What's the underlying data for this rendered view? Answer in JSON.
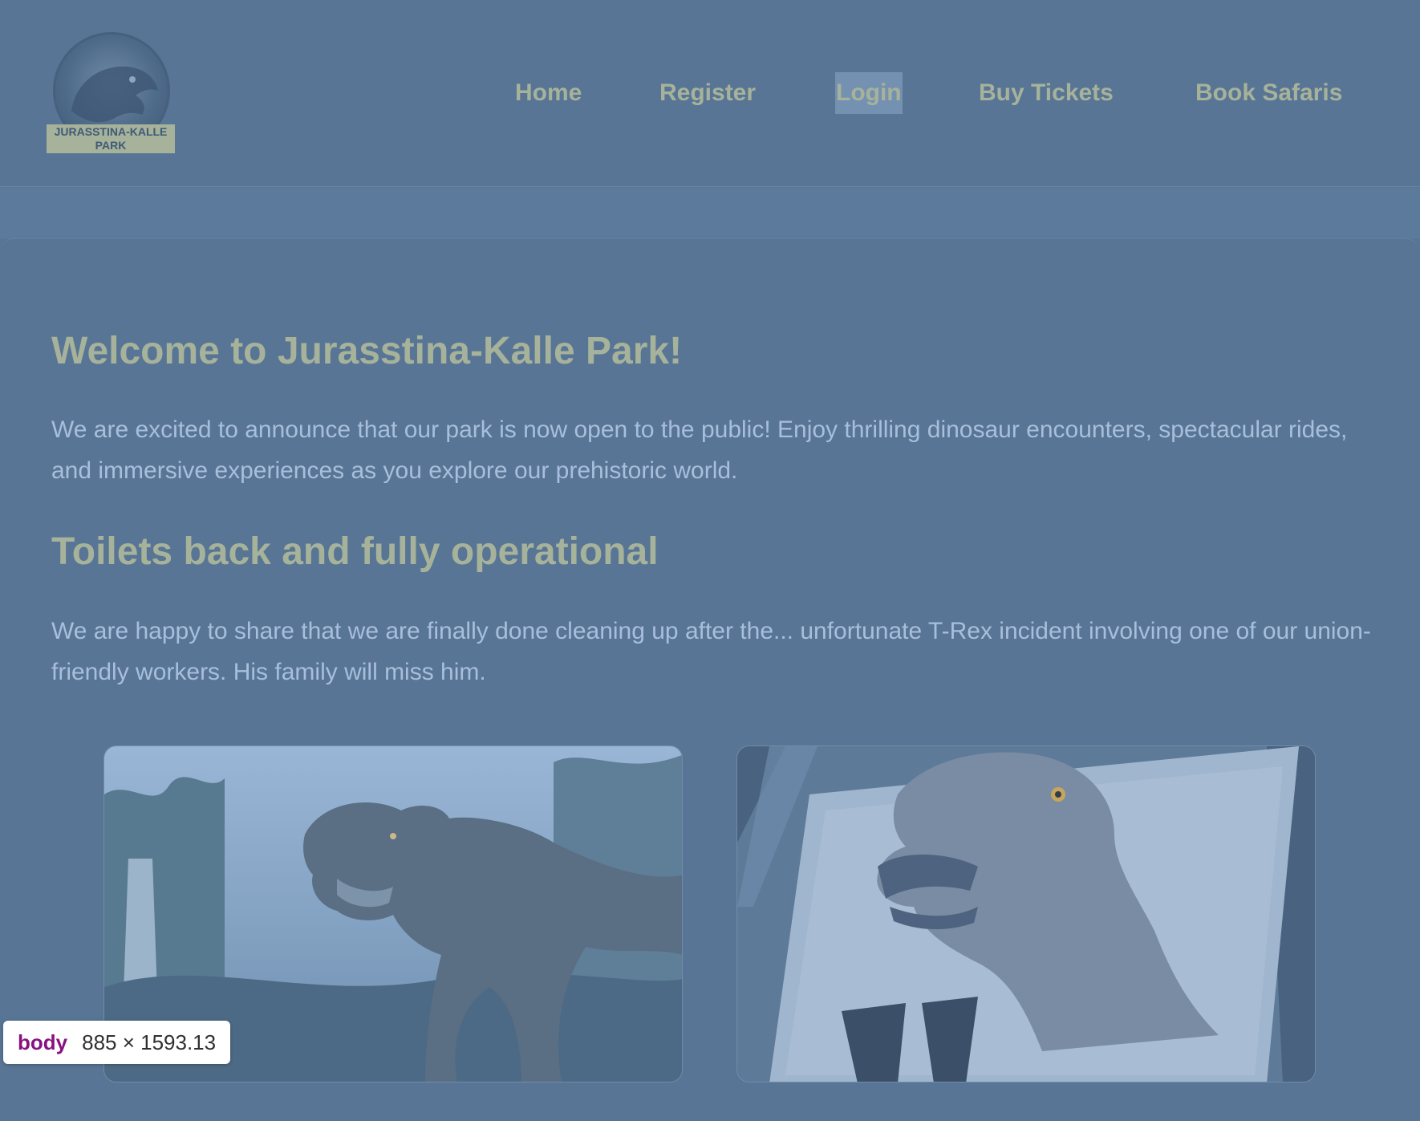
{
  "logo": {
    "text": "JURASSTINA-KALLE PARK",
    "icon": "dinosaur-head-logo"
  },
  "nav": {
    "items": [
      {
        "label": "Home",
        "active": false
      },
      {
        "label": "Register",
        "active": false
      },
      {
        "label": "Login",
        "active": true
      },
      {
        "label": "Buy Tickets",
        "active": false
      },
      {
        "label": "Book Safaris",
        "active": false
      }
    ]
  },
  "main": {
    "welcome_title": "Welcome to Jurasstina-Kalle Park!",
    "welcome_text": "We are excited to announce that our park is now open to the public! Enjoy thrilling dinosaur encounters, spectacular rides, and immersive experiences as you explore our prehistoric world.",
    "news_title": "Toilets back and fully operational",
    "news_text": "We are happy to share that we are finally done cleaning up after the... unfortunate T-Rex incident involving one of our union-friendly workers. His family will miss him.",
    "images": [
      {
        "subject": "t-rex-in-jungle-photo"
      },
      {
        "subject": "t-rex-wanted-poster-photo"
      }
    ]
  },
  "devtools": {
    "tag": "body",
    "size": "885 × 1593.13"
  },
  "colors": {
    "background": "#587595",
    "heading": "#a6b29a",
    "body_text": "#a7bfdc",
    "nav_active_bg": "#7591b1"
  }
}
